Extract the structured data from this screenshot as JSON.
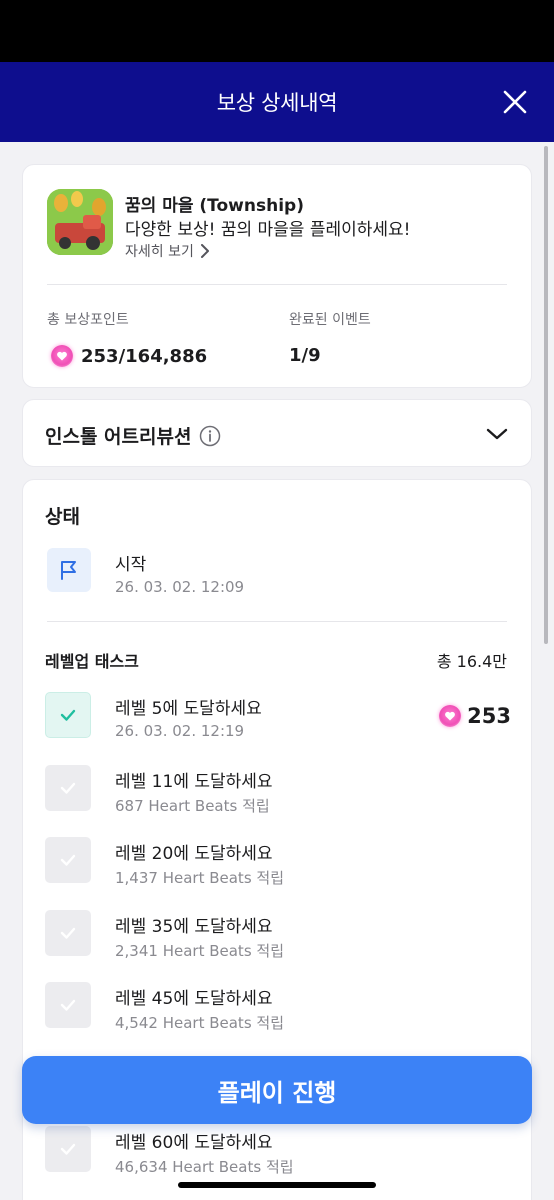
{
  "header": {
    "title": "보상 상세내역"
  },
  "app": {
    "name": "꿈의 마을 (Township)",
    "description": "다양한 보상! 꿈의 마을을 플레이하세요!",
    "detail_link": "자세히 보기"
  },
  "stats": {
    "total_label": "총 보상포인트",
    "total_value": "253/164,886",
    "completed_label": "완료된 이벤트",
    "completed_value": "1/9"
  },
  "attribution": {
    "title": "인스톨 어트리뷰션"
  },
  "status": {
    "title": "상태",
    "start_label": "시작",
    "start_time": "26. 03. 02. 12:09"
  },
  "tasks": {
    "header": "레벨업 태스크",
    "total": "총 16.4만",
    "items": [
      {
        "title": "레벨 5에 도달하세요",
        "sub": "26. 03. 02. 12:19",
        "reward": "253",
        "done": true
      },
      {
        "title": "레벨 11에 도달하세요",
        "sub": "687 Heart Beats 적립",
        "done": false
      },
      {
        "title": "레벨 20에 도달하세요",
        "sub": "1,437 Heart Beats 적립",
        "done": false
      },
      {
        "title": "레벨 35에 도달하세요",
        "sub": "2,341 Heart Beats 적립",
        "done": false
      },
      {
        "title": "레벨 45에 도달하세요",
        "sub": "4,542 Heart Beats 적립",
        "done": false
      },
      {
        "title": "레벨 60에 도달하세요",
        "sub": "46,634 Heart Beats 적립",
        "done": false
      }
    ]
  },
  "play_button": {
    "label": "플레이 진행"
  },
  "colors": {
    "header_bg": "#0e0e8e",
    "play_button": "#3c82f6",
    "check_done": "#1fbf9f",
    "heart": "#f04fb6"
  },
  "icons": {
    "close": "close-icon",
    "chevron_right": "chevron-right-icon",
    "info": "info-icon",
    "chevron_down": "chevron-down-icon",
    "flag": "flag-icon",
    "check": "check-icon",
    "heart": "heart-icon"
  }
}
